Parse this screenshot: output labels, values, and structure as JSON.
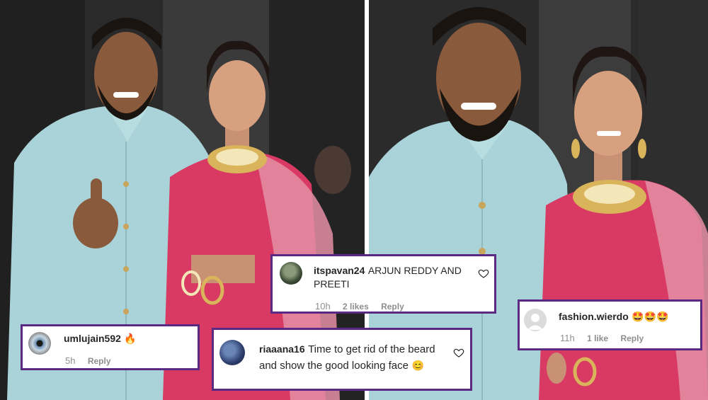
{
  "comments": [
    {
      "username": "itspavan24",
      "text": "ARJUN REDDY AND PREETI",
      "time": "10h",
      "likes": "2 likes",
      "reply": "Reply"
    },
    {
      "username": "fashion.wierdo",
      "text": "🤩🤩🤩",
      "time": "11h",
      "likes": "1 like",
      "reply": "Reply"
    },
    {
      "username": "umlujain592",
      "text": "🔥",
      "time": "5h",
      "reply": "Reply"
    },
    {
      "username": "riaaana16",
      "text": "Time to get rid of the beard and show the good looking face",
      "emoji": "😊",
      "reply": "Reply"
    }
  ],
  "colors": {
    "card_border": "#5a2a83",
    "sherwani": "#a9d3d8",
    "lehenga": "#d83a63",
    "dupatta": "#e58fa5",
    "gold": "#d9b45a"
  }
}
